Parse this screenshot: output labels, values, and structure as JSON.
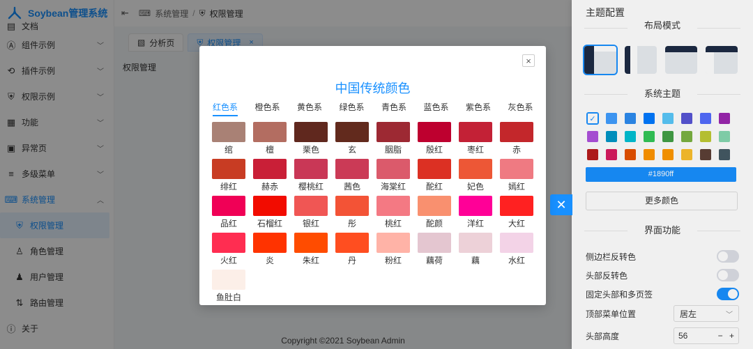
{
  "app": {
    "title": "Soybean管理系统"
  },
  "sidebar": {
    "items": [
      {
        "label": "文档",
        "icon": "document-icon"
      },
      {
        "label": "组件示例",
        "icon": "component-icon"
      },
      {
        "label": "插件示例",
        "icon": "plugin-icon"
      },
      {
        "label": "权限示例",
        "icon": "shield-icon"
      },
      {
        "label": "功能",
        "icon": "grid-icon"
      },
      {
        "label": "异常页",
        "icon": "exception-icon"
      },
      {
        "label": "多级菜单",
        "icon": "list-icon"
      },
      {
        "label": "系统管理",
        "icon": "system-icon"
      },
      {
        "label": "权限管理",
        "icon": "shield-icon"
      },
      {
        "label": "角色管理",
        "icon": "user-role-icon"
      },
      {
        "label": "用户管理",
        "icon": "users-icon"
      },
      {
        "label": "路由管理",
        "icon": "route-icon"
      },
      {
        "label": "关于",
        "icon": "info-icon"
      }
    ]
  },
  "header": {
    "breadcrumb": [
      "系统管理",
      "权限管理"
    ],
    "separator": "/"
  },
  "tabs": [
    {
      "label": "分析页"
    },
    {
      "label": "权限管理",
      "close": "×"
    }
  ],
  "content": {
    "title": "权限管理"
  },
  "footer": {
    "text": "Copyright ©2021 Soybean Admin"
  },
  "modal": {
    "title": "中国传统颜色",
    "close": "×",
    "tabs": [
      "红色系",
      "橙色系",
      "黄色系",
      "绿色系",
      "青色系",
      "蓝色系",
      "紫色系",
      "灰色系"
    ],
    "colors": [
      {
        "name": "绾",
        "hex": "#a98175"
      },
      {
        "name": "檀",
        "hex": "#b36d61"
      },
      {
        "name": "栗色",
        "hex": "#60281e"
      },
      {
        "name": "玄",
        "hex": "#622a1d"
      },
      {
        "name": "胭脂",
        "hex": "#9d2933"
      },
      {
        "name": "殷红",
        "hex": "#be002f"
      },
      {
        "name": "枣红",
        "hex": "#c32136"
      },
      {
        "name": "赤",
        "hex": "#c3272b"
      },
      {
        "name": "绯红",
        "hex": "#c83c23"
      },
      {
        "name": "赫赤",
        "hex": "#c91f37"
      },
      {
        "name": "樱桃红",
        "hex": "#c93756"
      },
      {
        "name": "茜色",
        "hex": "#cb3a56"
      },
      {
        "name": "海棠红",
        "hex": "#db5a6b"
      },
      {
        "name": "酡红",
        "hex": "#dc3023"
      },
      {
        "name": "妃色",
        "hex": "#ed5736"
      },
      {
        "name": "嫣红",
        "hex": "#ef7a82"
      },
      {
        "name": "品红",
        "hex": "#f00056"
      },
      {
        "name": "石榴红",
        "hex": "#f20c00"
      },
      {
        "name": "银红",
        "hex": "#f05654"
      },
      {
        "name": "彤",
        "hex": "#f35336"
      },
      {
        "name": "桃红",
        "hex": "#f47983"
      },
      {
        "name": "酡颜",
        "hex": "#f9906f"
      },
      {
        "name": "洋红",
        "hex": "#ff0097"
      },
      {
        "name": "大红",
        "hex": "#ff2121"
      },
      {
        "name": "火红",
        "hex": "#ff2d51"
      },
      {
        "name": "炎",
        "hex": "#ff3300"
      },
      {
        "name": "朱红",
        "hex": "#ff4c00"
      },
      {
        "name": "丹",
        "hex": "#ff4e20"
      },
      {
        "name": "粉红",
        "hex": "#ffb3a7"
      },
      {
        "name": "藕荷",
        "hex": "#e4c6d0"
      },
      {
        "name": "藕",
        "hex": "#edd1d8"
      },
      {
        "name": "水红",
        "hex": "#f3d3e7"
      },
      {
        "name": "鱼肚白",
        "hex": "#fcefe8"
      }
    ]
  },
  "drawer": {
    "title": "主题配置",
    "section_layout": "布局模式",
    "section_theme": "系统主题",
    "theme_colors": [
      "#1890ff",
      "#409eff",
      "#2d8cf0",
      "#007aff",
      "#5ac8fa",
      "#5856d6",
      "#536dfe",
      "#9c27b0",
      "#af52de",
      "#0096c7",
      "#00c1d4",
      "#34c759",
      "#43a047",
      "#7cb342",
      "#c0ca33",
      "#86d8b1",
      "#b71c1c",
      "#d81b60",
      "#e65100",
      "#ff9500",
      "#ff9800",
      "#fbc02d",
      "#5d4037",
      "#455a64"
    ],
    "selected_color": "#1890ff",
    "color_display": "#1890ff",
    "more_colors": "更多颜色",
    "section_ui": "界面功能",
    "settings": [
      {
        "label": "侧边栏反转色",
        "on": false
      },
      {
        "label": "头部反转色",
        "on": false
      },
      {
        "label": "固定头部和多页签",
        "on": true
      }
    ],
    "top_menu_label": "顶部菜单位置",
    "top_menu_value": "居左",
    "header_height_label": "头部高度",
    "header_height_value": "56",
    "stepper_minus": "−",
    "stepper_plus": "+",
    "check": "✓"
  }
}
